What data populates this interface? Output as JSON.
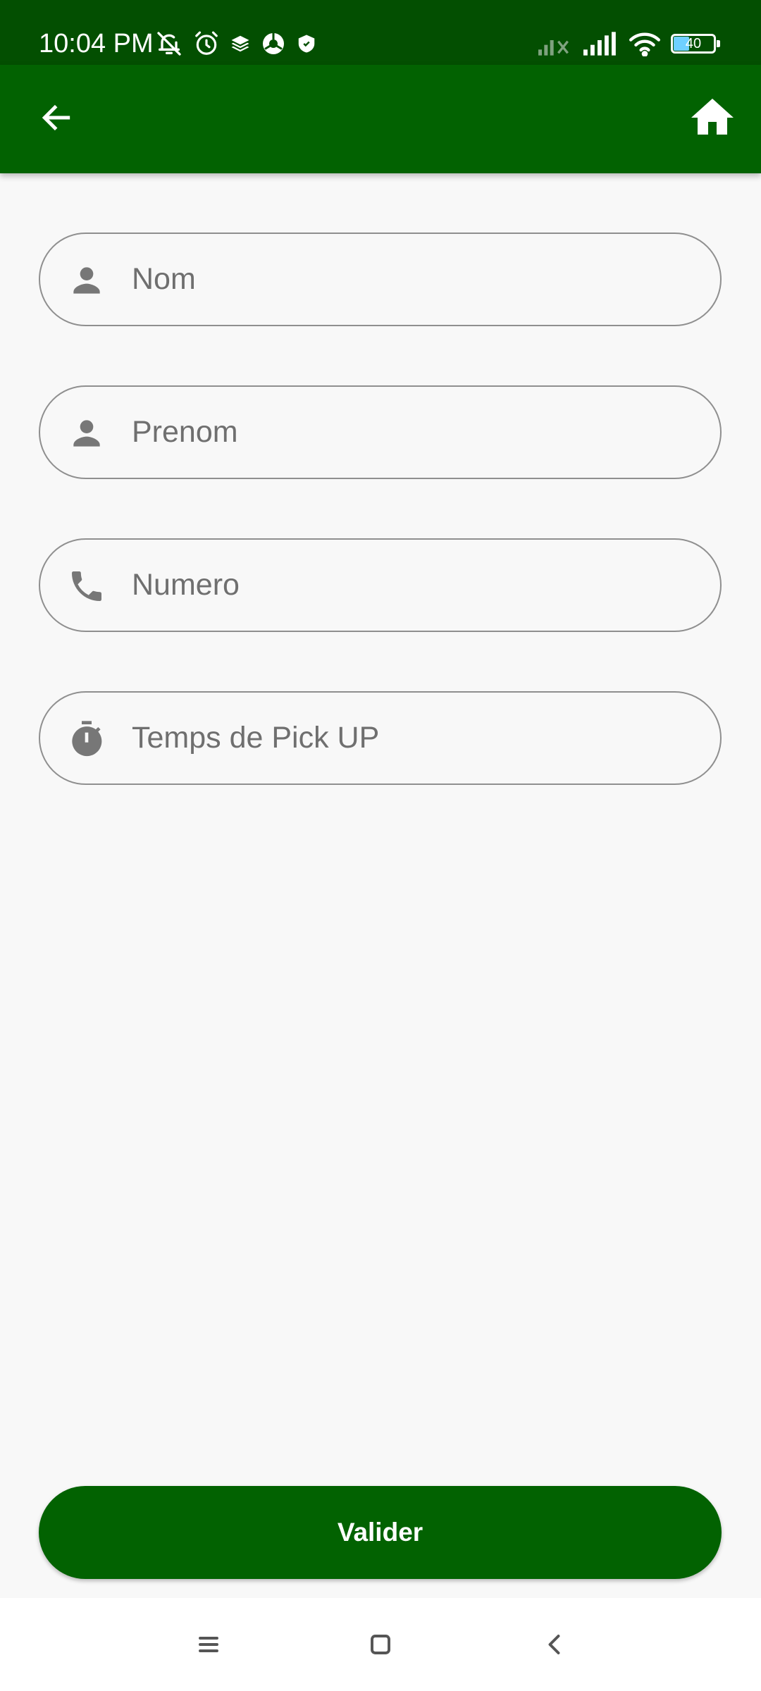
{
  "status_bar": {
    "time": "10:04 PM",
    "battery_level": "40",
    "icons": [
      "mute-bell-icon",
      "alarm-icon",
      "layers-icon",
      "browser-icon",
      "shield-icon",
      "signal-off-icon",
      "signal-icon",
      "wifi-icon",
      "battery-icon"
    ]
  },
  "app_bar": {
    "back_icon": "arrow-back-icon",
    "home_icon": "home-icon"
  },
  "form": {
    "fields": [
      {
        "placeholder": "Nom",
        "value": "",
        "icon": "person-icon"
      },
      {
        "placeholder": "Prenom",
        "value": "",
        "icon": "person-icon"
      },
      {
        "placeholder": "Numero",
        "value": "",
        "icon": "phone-icon"
      },
      {
        "placeholder": "Temps de Pick UP",
        "value": "",
        "icon": "timer-icon"
      }
    ],
    "submit_label": "Valider"
  },
  "system_nav": {
    "icons": [
      "menu-icon",
      "home-square-icon",
      "back-chevron-icon"
    ]
  },
  "colors": {
    "status_bar": "#034f01",
    "primary": "#026201",
    "background": "#f8f8f8",
    "field_border": "#8f8f8f",
    "icon_gray": "#777777"
  }
}
